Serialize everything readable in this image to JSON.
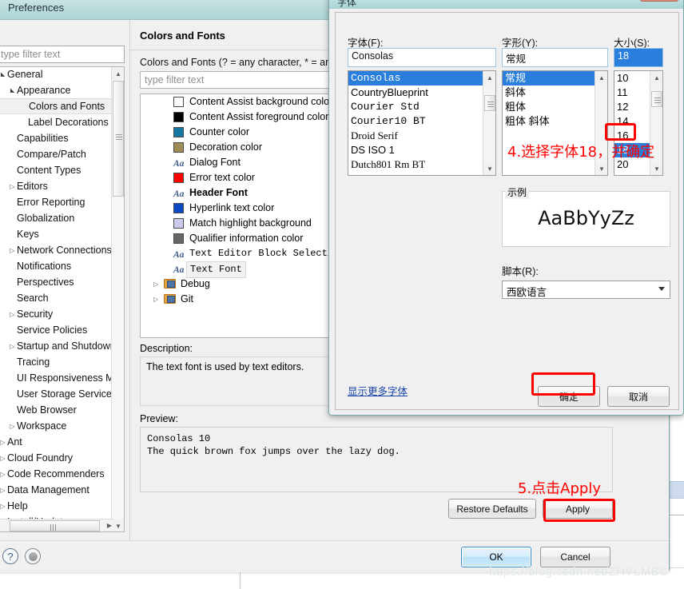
{
  "preferences": {
    "title": "Preferences",
    "filter_placeholder": "type filter text",
    "tree": [
      {
        "label": "General",
        "indent": 0,
        "arrow": "open"
      },
      {
        "label": "Appearance",
        "indent": 1,
        "arrow": "open"
      },
      {
        "label": "Colors and Fonts",
        "indent": 2,
        "arrow": "none",
        "selected": true
      },
      {
        "label": "Label Decorations",
        "indent": 2,
        "arrow": "none"
      },
      {
        "label": "Capabilities",
        "indent": 1,
        "arrow": "none"
      },
      {
        "label": "Compare/Patch",
        "indent": 1,
        "arrow": "none"
      },
      {
        "label": "Content Types",
        "indent": 1,
        "arrow": "none"
      },
      {
        "label": "Editors",
        "indent": 1,
        "arrow": "closed"
      },
      {
        "label": "Error Reporting",
        "indent": 1,
        "arrow": "none"
      },
      {
        "label": "Globalization",
        "indent": 1,
        "arrow": "none"
      },
      {
        "label": "Keys",
        "indent": 1,
        "arrow": "none"
      },
      {
        "label": "Network Connections",
        "indent": 1,
        "arrow": "closed"
      },
      {
        "label": "Notifications",
        "indent": 1,
        "arrow": "none"
      },
      {
        "label": "Perspectives",
        "indent": 1,
        "arrow": "none"
      },
      {
        "label": "Search",
        "indent": 1,
        "arrow": "none"
      },
      {
        "label": "Security",
        "indent": 1,
        "arrow": "closed"
      },
      {
        "label": "Service Policies",
        "indent": 1,
        "arrow": "none"
      },
      {
        "label": "Startup and Shutdown",
        "indent": 1,
        "arrow": "closed"
      },
      {
        "label": "Tracing",
        "indent": 1,
        "arrow": "none"
      },
      {
        "label": "UI Responsiveness Monitoring",
        "indent": 1,
        "arrow": "none"
      },
      {
        "label": "User Storage Service",
        "indent": 1,
        "arrow": "none"
      },
      {
        "label": "Web Browser",
        "indent": 1,
        "arrow": "none"
      },
      {
        "label": "Workspace",
        "indent": 1,
        "arrow": "closed"
      },
      {
        "label": "Ant",
        "indent": 0,
        "arrow": "closed"
      },
      {
        "label": "Cloud Foundry",
        "indent": 0,
        "arrow": "closed"
      },
      {
        "label": "Code Recommenders",
        "indent": 0,
        "arrow": "closed"
      },
      {
        "label": "Data Management",
        "indent": 0,
        "arrow": "closed"
      },
      {
        "label": "Help",
        "indent": 0,
        "arrow": "closed"
      },
      {
        "label": "Install/Update",
        "indent": 0,
        "arrow": "closed"
      }
    ],
    "page": {
      "title": "Colors and Fonts",
      "description_line": "Colors and Fonts (? = any character, * = any string):",
      "filter_placeholder": "type filter text",
      "items": [
        {
          "label": "Content Assist background color",
          "kind": "swatch",
          "color": "#ffffff"
        },
        {
          "label": "Content Assist foreground color",
          "kind": "swatch",
          "color": "#000000"
        },
        {
          "label": "Counter color",
          "kind": "swatch",
          "color": "#1577a0"
        },
        {
          "label": "Decoration color",
          "kind": "swatch",
          "color": "#a08c56"
        },
        {
          "label": "Dialog Font",
          "kind": "font"
        },
        {
          "label": "Error text color",
          "kind": "swatch",
          "color": "#ff0000"
        },
        {
          "label": "Header Font",
          "kind": "font",
          "bold": true
        },
        {
          "label": "Hyperlink text color",
          "kind": "swatch",
          "color": "#0b49c4"
        },
        {
          "label": "Match highlight background",
          "kind": "swatch",
          "color": "#cbcbee"
        },
        {
          "label": "Qualifier information color",
          "kind": "swatch",
          "color": "#666666"
        },
        {
          "label": "Text Editor Block Selection",
          "kind": "font",
          "mono": true
        },
        {
          "label": "Text Font",
          "kind": "font",
          "mono": true,
          "selected": true
        }
      ],
      "folders": [
        {
          "label": "Debug"
        },
        {
          "label": "Git"
        }
      ],
      "description_label": "Description:",
      "description_text": "The text font is used by text editors.",
      "preview_label": "Preview:",
      "preview_text": "Consolas 10\nThe quick brown fox jumps over the lazy dog.",
      "restore_defaults_label": "Restore Defaults",
      "apply_label": "Apply"
    },
    "footer": {
      "ok_label": "OK",
      "cancel_label": "Cancel"
    }
  },
  "font_dialog": {
    "title": "字体",
    "font_label": "字体(F):",
    "font_value": "Consolas",
    "font_list": [
      "Consolas",
      "CountryBlueprint",
      "Courier Std",
      "Courier10 BT",
      "Droid Serif",
      "DS ISO 1",
      "Dutch801 Rm BT"
    ],
    "font_selected": "Consolas",
    "style_label": "字形(Y):",
    "style_value": "常规",
    "style_list": [
      "常规",
      "斜体",
      "粗体",
      "粗体 斜体"
    ],
    "style_selected": "常规",
    "size_label": "大小(S):",
    "size_value": "18",
    "size_list": [
      "10",
      "11",
      "12",
      "14",
      "16",
      "18",
      "20"
    ],
    "size_selected": "18",
    "sample_legend": "示例",
    "sample_text": "AaBbYyZz",
    "script_label": "脚本(R):",
    "script_value": "西欧语言",
    "more_fonts_link": "显示更多字体",
    "ok_label": "确定",
    "cancel_label": "取消"
  },
  "annotations": [
    {
      "id": "step4",
      "text": "4.选择字体18，并确定",
      "color": "#ff0000"
    },
    {
      "id": "step5",
      "text": "5.点击Apply",
      "color": "#ff0000"
    }
  ],
  "watermark": "https://blog.csdn.net/ZHYLMBC"
}
